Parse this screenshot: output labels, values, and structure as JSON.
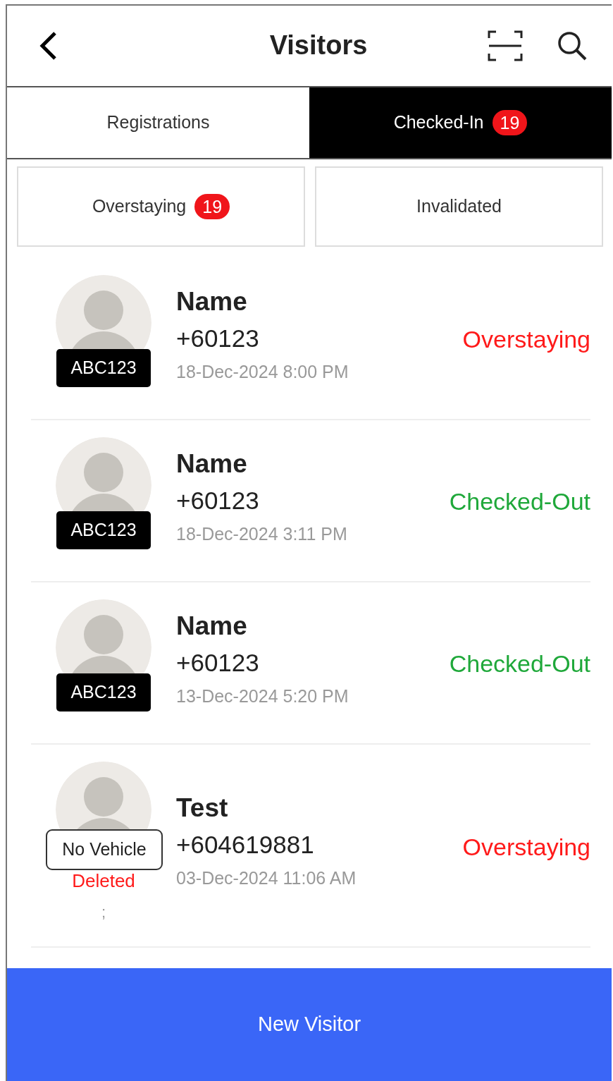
{
  "header": {
    "title": "Visitors"
  },
  "tabs": [
    {
      "label": "Registrations",
      "selected": false
    },
    {
      "label": "Checked-In",
      "badge": "19",
      "selected": true
    }
  ],
  "filters": [
    {
      "label": "Overstaying",
      "badge": "19"
    },
    {
      "label": "Invalidated"
    }
  ],
  "visitors": [
    {
      "vehicle": {
        "kind": "plate",
        "text": "ABC123"
      },
      "name": "Name",
      "phone": "+60123",
      "time": "18-Dec-2024 8:00 PM",
      "status": "Overstaying",
      "color": "#ff1a1a"
    },
    {
      "vehicle": {
        "kind": "plate",
        "text": "ABC123"
      },
      "name": "Name",
      "phone": "+60123",
      "time": "18-Dec-2024 3:11 PM",
      "status": "Checked-Out",
      "color": "#1fa83a"
    },
    {
      "vehicle": {
        "kind": "plate",
        "text": "ABC123"
      },
      "name": "Name",
      "phone": "+60123",
      "time": "13-Dec-2024 5:20 PM",
      "status": "Checked-Out",
      "color": "#1fa83a"
    },
    {
      "vehicle": {
        "kind": "none",
        "text": "No Vehicle"
      },
      "note": "Deleted",
      "extra": ";",
      "name": "Test",
      "phone": "+604619881",
      "time": "03-Dec-2024 11:06 AM",
      "status": "Overstaying",
      "color": "#ff1a1a"
    }
  ],
  "footer": {
    "button": "New Visitor"
  }
}
